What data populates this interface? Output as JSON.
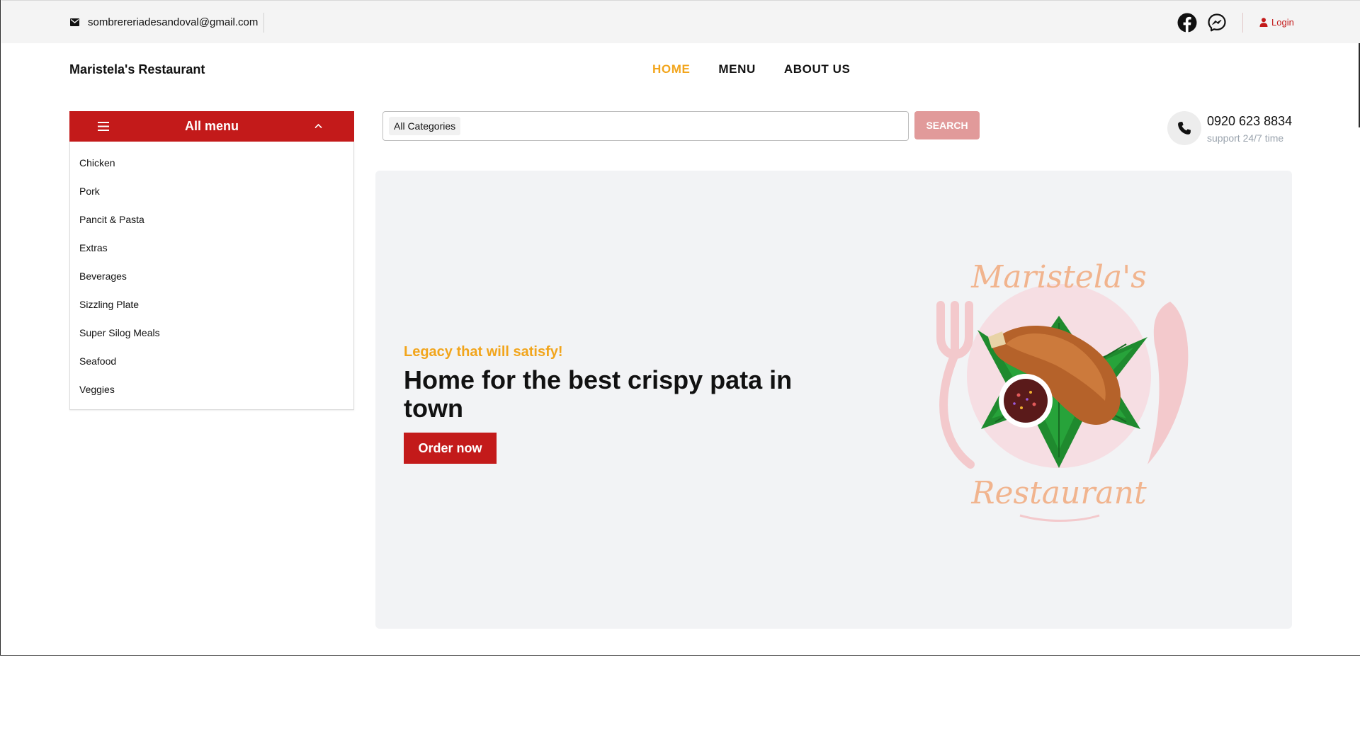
{
  "topbar": {
    "email": "sombrereriadesandoval@gmail.com",
    "social": [
      "facebook-icon",
      "messenger-icon"
    ],
    "login_label": "Login"
  },
  "header": {
    "brand": "Maristela's Restaurant",
    "nav": [
      {
        "label": "HOME",
        "active": true
      },
      {
        "label": "MENU",
        "active": false
      },
      {
        "label": "ABOUT US",
        "active": false
      }
    ]
  },
  "sidebar": {
    "title": "All menu",
    "items": [
      {
        "label": "Chicken"
      },
      {
        "label": "Pork"
      },
      {
        "label": "Pancit & Pasta"
      },
      {
        "label": "Extras"
      },
      {
        "label": "Beverages"
      },
      {
        "label": "Sizzling Plate"
      },
      {
        "label": "Super Silog Meals"
      },
      {
        "label": "Seafood"
      },
      {
        "label": "Veggies"
      }
    ]
  },
  "search": {
    "category": "All Categories",
    "value": "",
    "placeholder": "",
    "button_label": "SEARCH"
  },
  "contact": {
    "phone": "0920 623 8834",
    "support": "support 24/7 time"
  },
  "hero": {
    "tagline": "Legacy that will satisfy!",
    "headline": "Home for the best crispy pata in town",
    "cta_label": "Order now",
    "logo_top_text": "Maristela's",
    "logo_bottom_text": "Restaurant"
  },
  "colors": {
    "brand_red": "#c31a1a",
    "accent_orange": "#f2a51c",
    "search_button": "#e19a9a",
    "hero_background": "#f2f3f5"
  }
}
